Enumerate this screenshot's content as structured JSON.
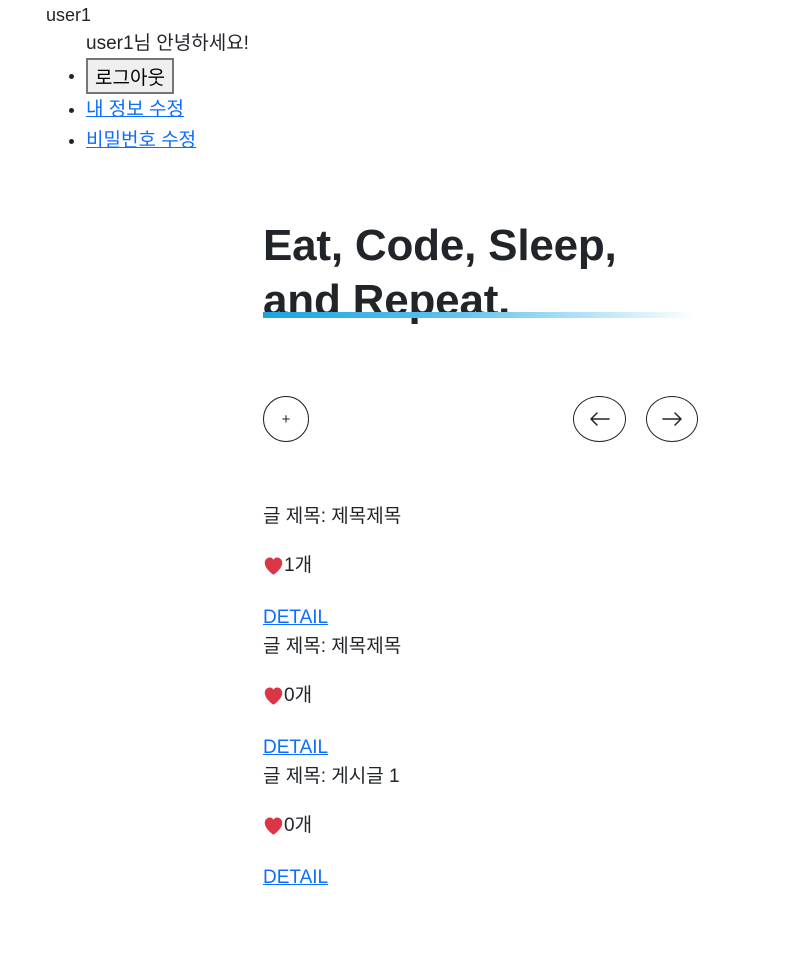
{
  "header": {
    "username": "user1",
    "greeting": "user1님 안녕하세요!"
  },
  "user_menu": {
    "logout_label": "로그아웃",
    "edit_profile_label": "내 정보 수정",
    "change_password_label": "비밀번호 수정"
  },
  "hero": {
    "title_line1": "Eat, Code, Sleep,",
    "title_line2": "and Repeat."
  },
  "controls": {
    "add_symbol": "+",
    "prev_icon": "arrow-left-icon",
    "next_icon": "arrow-right-icon"
  },
  "posts": [
    {
      "title": "글 제목: 제목제목",
      "likes": "1개",
      "detail_label": "DETAIL"
    },
    {
      "title": "글 제목: 제목제목",
      "likes": "0개",
      "detail_label": "DETAIL"
    },
    {
      "title": "글 제목: 게시글 1",
      "likes": "0개",
      "detail_label": "DETAIL"
    }
  ],
  "colors": {
    "text": "#212529",
    "link": "#0d6efd",
    "heart": "#dc3545",
    "accent_line": "#1aa3e0"
  }
}
